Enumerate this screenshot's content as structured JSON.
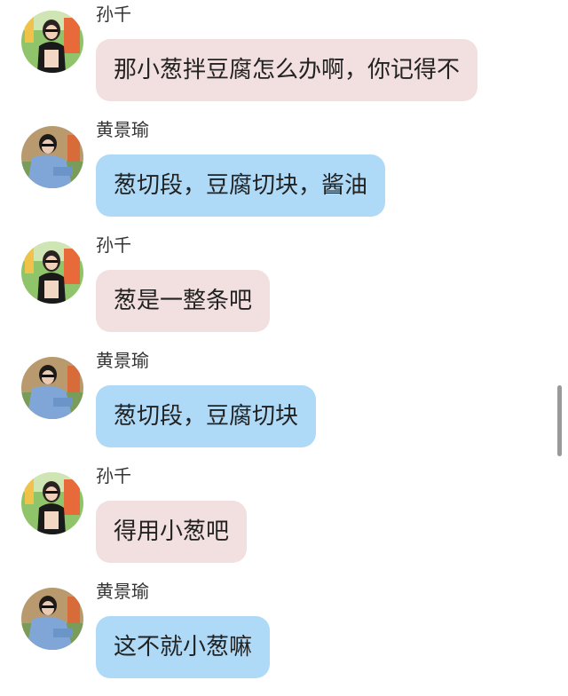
{
  "accent_colors": {
    "pink_bubble": "#f1e0df",
    "blue_bubble": "#afdaf7"
  },
  "messages": [
    {
      "sender": "孙千",
      "text": "那小葱拌豆腐怎么办啊，你记得不",
      "avatar": "sunqian-avatar"
    },
    {
      "sender": "黄景瑜",
      "text": "葱切段，豆腐切块，酱油",
      "avatar": "huangjingyu-avatar"
    },
    {
      "sender": "孙千",
      "text": "葱是一整条吧",
      "avatar": "sunqian-avatar"
    },
    {
      "sender": "黄景瑜",
      "text": "葱切段，豆腐切块",
      "avatar": "huangjingyu-avatar"
    },
    {
      "sender": "孙千",
      "text": "得用小葱吧",
      "avatar": "sunqian-avatar"
    },
    {
      "sender": "黄景瑜",
      "text": "这不就小葱嘛",
      "avatar": "huangjingyu-avatar"
    }
  ]
}
